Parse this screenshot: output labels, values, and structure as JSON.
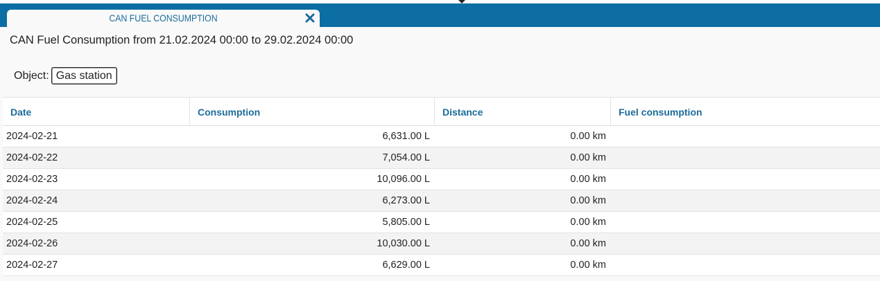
{
  "tab": {
    "title": "CAN FUEL CONSUMPTION",
    "close_icon": "close-icon"
  },
  "report": {
    "title": "CAN Fuel Consumption from 21.02.2024 00:00 to 29.02.2024 00:00",
    "object_label": "Object:",
    "object_value": "Gas station"
  },
  "table": {
    "headers": {
      "date": "Date",
      "consumption": "Consumption",
      "distance": "Distance",
      "fuel_consumption": "Fuel consumption"
    },
    "rows": [
      {
        "date": "2024-02-21",
        "consumption": "6,631.00 L",
        "distance": "0.00 km",
        "fuel_consumption": ""
      },
      {
        "date": "2024-02-22",
        "consumption": "7,054.00 L",
        "distance": "0.00 km",
        "fuel_consumption": ""
      },
      {
        "date": "2024-02-23",
        "consumption": "10,096.00 L",
        "distance": "0.00 km",
        "fuel_consumption": ""
      },
      {
        "date": "2024-02-24",
        "consumption": "6,273.00 L",
        "distance": "0.00 km",
        "fuel_consumption": ""
      },
      {
        "date": "2024-02-25",
        "consumption": "5,805.00 L",
        "distance": "0.00 km",
        "fuel_consumption": ""
      },
      {
        "date": "2024-02-26",
        "consumption": "10,030.00 L",
        "distance": "0.00 km",
        "fuel_consumption": ""
      },
      {
        "date": "2024-02-27",
        "consumption": "6,629.00 L",
        "distance": "0.00 km",
        "fuel_consumption": ""
      }
    ]
  },
  "colors": {
    "header_bar": "#0c6ea3",
    "accent_text": "#1b6c9a"
  }
}
